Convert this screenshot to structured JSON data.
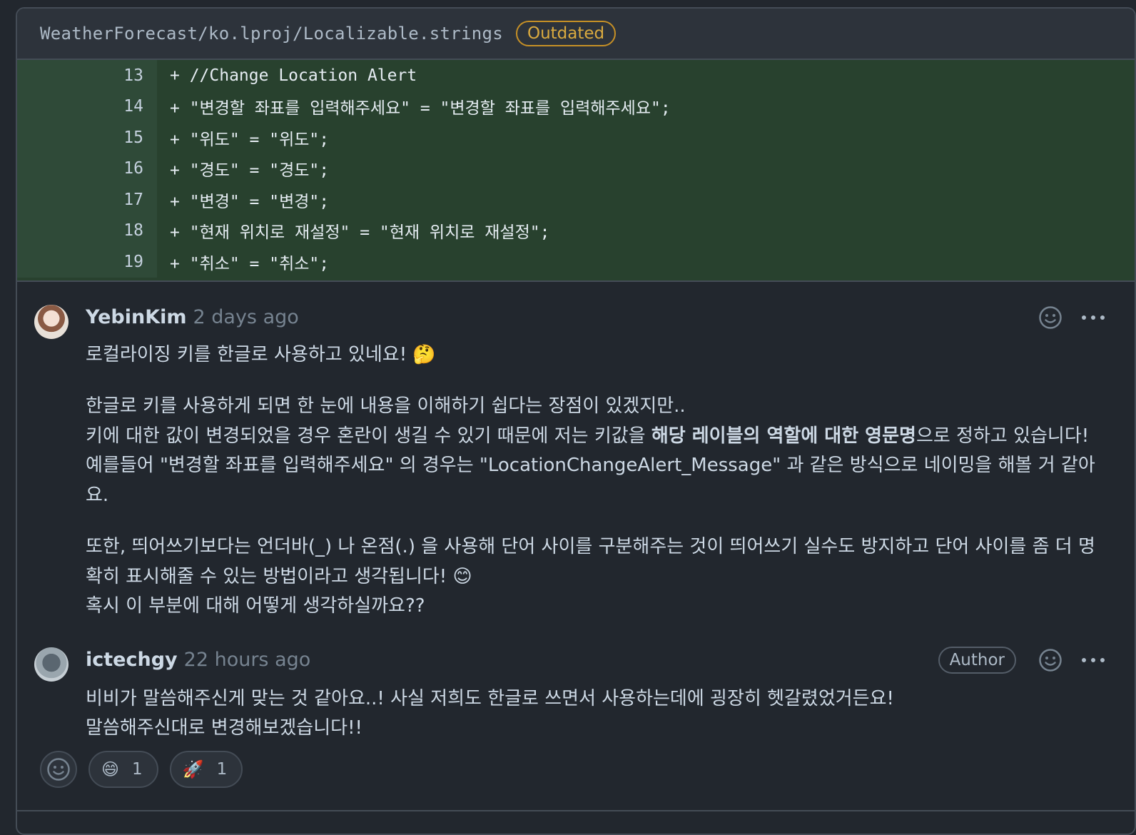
{
  "file": {
    "path": "WeatherForecast/ko.lproj/Localizable.strings",
    "badge": "Outdated"
  },
  "diff_lines": [
    {
      "num": "13",
      "code": "+ //Change Location Alert"
    },
    {
      "num": "14",
      "code": "+ \"변경할 좌표를 입력해주세요\" = \"변경할 좌표를 입력해주세요\";"
    },
    {
      "num": "15",
      "code": "+ \"위도\" = \"위도\";"
    },
    {
      "num": "16",
      "code": "+ \"경도\" = \"경도\";"
    },
    {
      "num": "17",
      "code": "+ \"변경\" = \"변경\";"
    },
    {
      "num": "18",
      "code": "+ \"현재 위치로 재설정\" = \"현재 위치로 재설정\";"
    },
    {
      "num": "19",
      "code": "+ \"취소\" = \"취소\";"
    }
  ],
  "comments": [
    {
      "author": "YebinKim",
      "time": "2 days ago",
      "p1": "로컬라이징 키를 한글로 사용하고 있네요! 🤔",
      "p2_l1": "한글로 키를 사용하게 되면 한 눈에 내용을 이해하기 쉽다는 장점이 있겠지만..",
      "p2_l2_a": "키에 대한 값이 변경되었을 경우 혼란이 생길 수 있기 때문에 저는 키값을 ",
      "p2_l2_b": "해당 레이블의 역할에 대한 영문명",
      "p2_l2_c": "으로 정하고 있습니다!",
      "p2_l3": "예를들어 \"변경할 좌표를 입력해주세요\" 의 경우는 \"LocationChangeAlert_Message\" 과 같은 방식으로 네이밍을 해볼 거 같아요.",
      "p3_l1": "또한, 띄어쓰기보다는 언더바(_) 나 온점(.) 을 사용해 단어 사이를 구분해주는 것이 띄어쓰기 실수도 방지하고 단어 사이를 좀 더 명확히 표시해줄 수 있는 방법이라고 생각됩니다! 😊",
      "p3_l2": "혹시 이 부분에 대해 어떻게 생각하실까요??"
    },
    {
      "author": "ictechgy",
      "time": "22 hours ago",
      "badge": "Author",
      "l1": "비비가 말씀해주신게 맞는 것 같아요..! 사실 저희도 한글로 쓰면서 사용하는데에 굉장히 헷갈렸었거든요!",
      "l2": "말씀해주신대로 변경해보겠습니다!!"
    }
  ],
  "reactions": [
    {
      "emoji": "😄",
      "count": "1"
    },
    {
      "emoji": "🚀",
      "count": "1"
    }
  ]
}
